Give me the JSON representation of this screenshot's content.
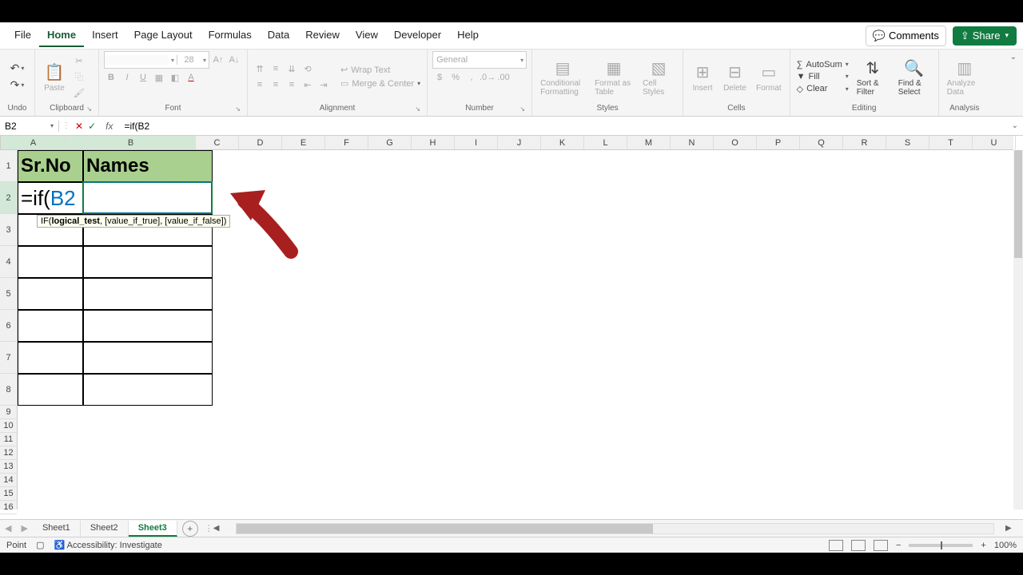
{
  "tabs": {
    "items": [
      "File",
      "Home",
      "Insert",
      "Page Layout",
      "Formulas",
      "Data",
      "Review",
      "View",
      "Developer",
      "Help"
    ],
    "active": "Home",
    "comments": "Comments",
    "share": "Share"
  },
  "ribbon": {
    "undo": "Undo",
    "clipboard": {
      "label": "Clipboard",
      "paste": "Paste"
    },
    "font": {
      "label": "Font",
      "size": "28"
    },
    "alignment": {
      "label": "Alignment",
      "wrap": "Wrap Text",
      "merge": "Merge & Center"
    },
    "number": {
      "label": "Number",
      "format": "General"
    },
    "styles": {
      "label": "Styles",
      "cond": "Conditional Formatting",
      "table": "Format as Table",
      "cell": "Cell Styles"
    },
    "cells": {
      "label": "Cells",
      "insert": "Insert",
      "delete": "Delete",
      "format": "Format"
    },
    "editing": {
      "label": "Editing",
      "autosum": "AutoSum",
      "fill": "Fill",
      "clear": "Clear",
      "sort": "Sort & Filter",
      "find": "Find & Select"
    },
    "analysis": {
      "label": "Analysis",
      "analyze": "Analyze Data"
    }
  },
  "formula_bar": {
    "cell_ref": "B2",
    "formula": "=if(B2"
  },
  "grid": {
    "cols": [
      "A",
      "B",
      "C",
      "D",
      "E",
      "F",
      "G",
      "H",
      "I",
      "J",
      "K",
      "L",
      "M",
      "N",
      "O",
      "P",
      "Q",
      "R",
      "S",
      "T",
      "U"
    ],
    "col_widths": {
      "A": 82,
      "B": 162,
      "default": 54
    },
    "big_row_h": 40,
    "small_row_h": 17,
    "big_rows": 8,
    "headers": {
      "a1": "Sr.No",
      "b1": "Names"
    },
    "editing": {
      "prefix": "=if(",
      "ref": "B2"
    },
    "tooltip_parts": {
      "fn": "IF(",
      "arg1": "logical_test",
      "rest": ", [value_if_true], [value_if_false])"
    }
  },
  "sheets": {
    "items": [
      "Sheet1",
      "Sheet2",
      "Sheet3"
    ],
    "active": "Sheet3"
  },
  "status": {
    "mode": "Point",
    "access": "Accessibility: Investigate",
    "zoom": "100%"
  }
}
